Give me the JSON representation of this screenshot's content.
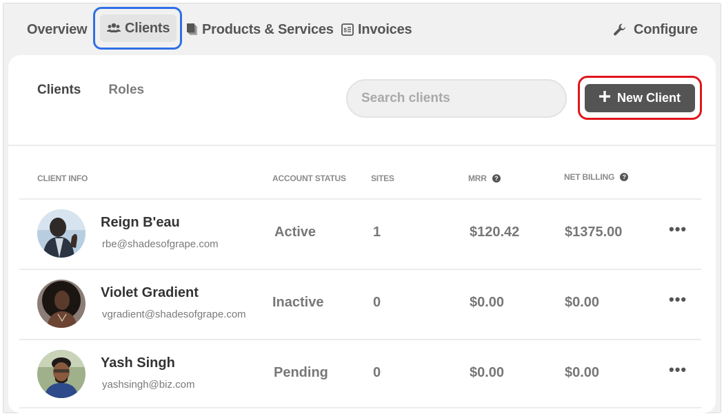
{
  "nav": {
    "items": [
      {
        "label": "Overview",
        "icon": null
      },
      {
        "label": "Clients",
        "icon": "users-icon",
        "active": true
      },
      {
        "label": "Products & Services",
        "icon": "stack-icon"
      },
      {
        "label": "Invoices",
        "icon": "invoice-icon"
      }
    ],
    "configure": {
      "label": "Configure",
      "icon": "wrench-icon"
    }
  },
  "subtabs": [
    {
      "label": "Clients",
      "active": true
    },
    {
      "label": "Roles",
      "active": false
    }
  ],
  "search": {
    "placeholder": "Search clients",
    "value": ""
  },
  "new_client_button": {
    "label": "New Client",
    "icon": "plus-icon"
  },
  "table": {
    "columns": [
      "CLIENT INFO",
      "ACCOUNT STATUS",
      "SITES",
      "MRR",
      "NET BILLING"
    ],
    "rows": [
      {
        "name": "Reign B'eau",
        "email": "rbe@shadesofgrape.com",
        "status": "Active",
        "sites": "1",
        "mrr": "$120.42",
        "net_billing": "$1375.00",
        "more": "•••"
      },
      {
        "name": "Violet Gradient",
        "email": "vgradient@shadesofgrape.com",
        "status": "Inactive",
        "sites": "0",
        "mrr": "$0.00",
        "net_billing": "$0.00",
        "more": "•••"
      },
      {
        "name": "Yash Singh",
        "email": "yashsingh@biz.com",
        "status": "Pending",
        "sites": "0",
        "mrr": "$0.00",
        "net_billing": "$0.00",
        "more": "•••"
      }
    ]
  },
  "colors": {
    "highlight_blue": "#2e6fe6",
    "highlight_red": "#e0141b",
    "button_bg": "#545454"
  }
}
